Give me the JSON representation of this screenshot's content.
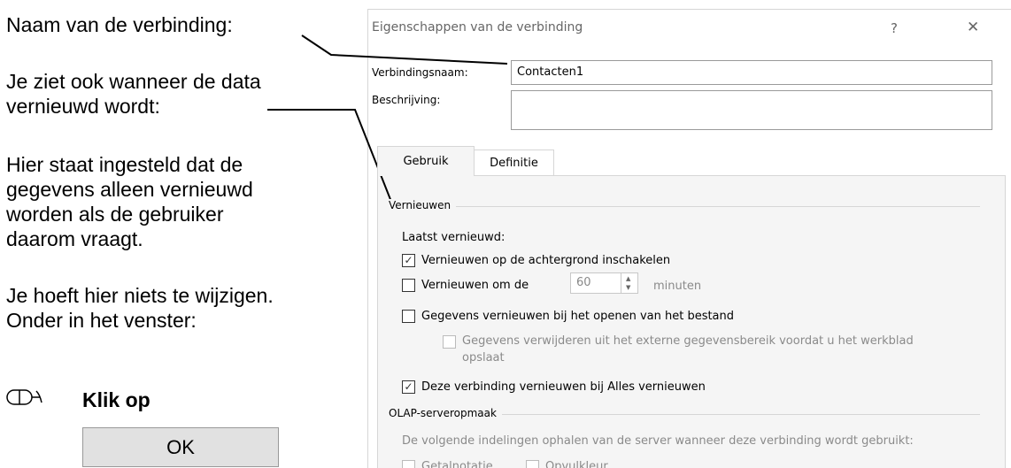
{
  "left": {
    "line1": "Naam van de verbinding:",
    "line2": "Je ziet ook wanneer de data",
    "line3": "vernieuwd wordt:",
    "line4": "Hier staat ingesteld dat de",
    "line5": "gegevens alleen vernieuwd",
    "line6": "worden als de gebruiker",
    "line7": "daarom vraagt.",
    "line8": "Je hoeft hier niets te wijzigen.",
    "line9": "Onder in het venster:",
    "klik": "Klik op",
    "ok_label": "OK",
    "mouse_icon": "mouse-click-icon"
  },
  "dialog": {
    "title": "Eigenschappen van de verbinding",
    "help": "?",
    "close": "✕",
    "name_label": "Verbindingsnaam:",
    "name_value": "Contacten1",
    "desc_label": "Beschrijving:",
    "desc_value": "",
    "tabs": [
      "Gebruik",
      "Definitie"
    ],
    "group_refresh": "Vernieuwen",
    "last_refreshed": "Laatst vernieuwd:",
    "opt_background": "Vernieuwen op de achtergrond inschakelen",
    "opt_every": "Vernieuwen om de",
    "opt_every_value": "60",
    "opt_minutes": "minuten",
    "opt_on_open": "Gegevens vernieuwen bij het openen van het bestand",
    "opt_remove_line1": "Gegevens verwijderen uit het externe gegevensbereik voordat u het werkblad",
    "opt_remove_line2": "opslaat",
    "opt_refresh_all": "Deze verbinding vernieuwen bij Alles vernieuwen",
    "group_olap": "OLAP-serveropmaak",
    "olap_desc": "De volgende indelingen ophalen van de server wanneer deze verbinding wordt gebruikt:",
    "olap_opt1": "Getalnotatie",
    "olap_opt2": "Opvulkleur"
  }
}
